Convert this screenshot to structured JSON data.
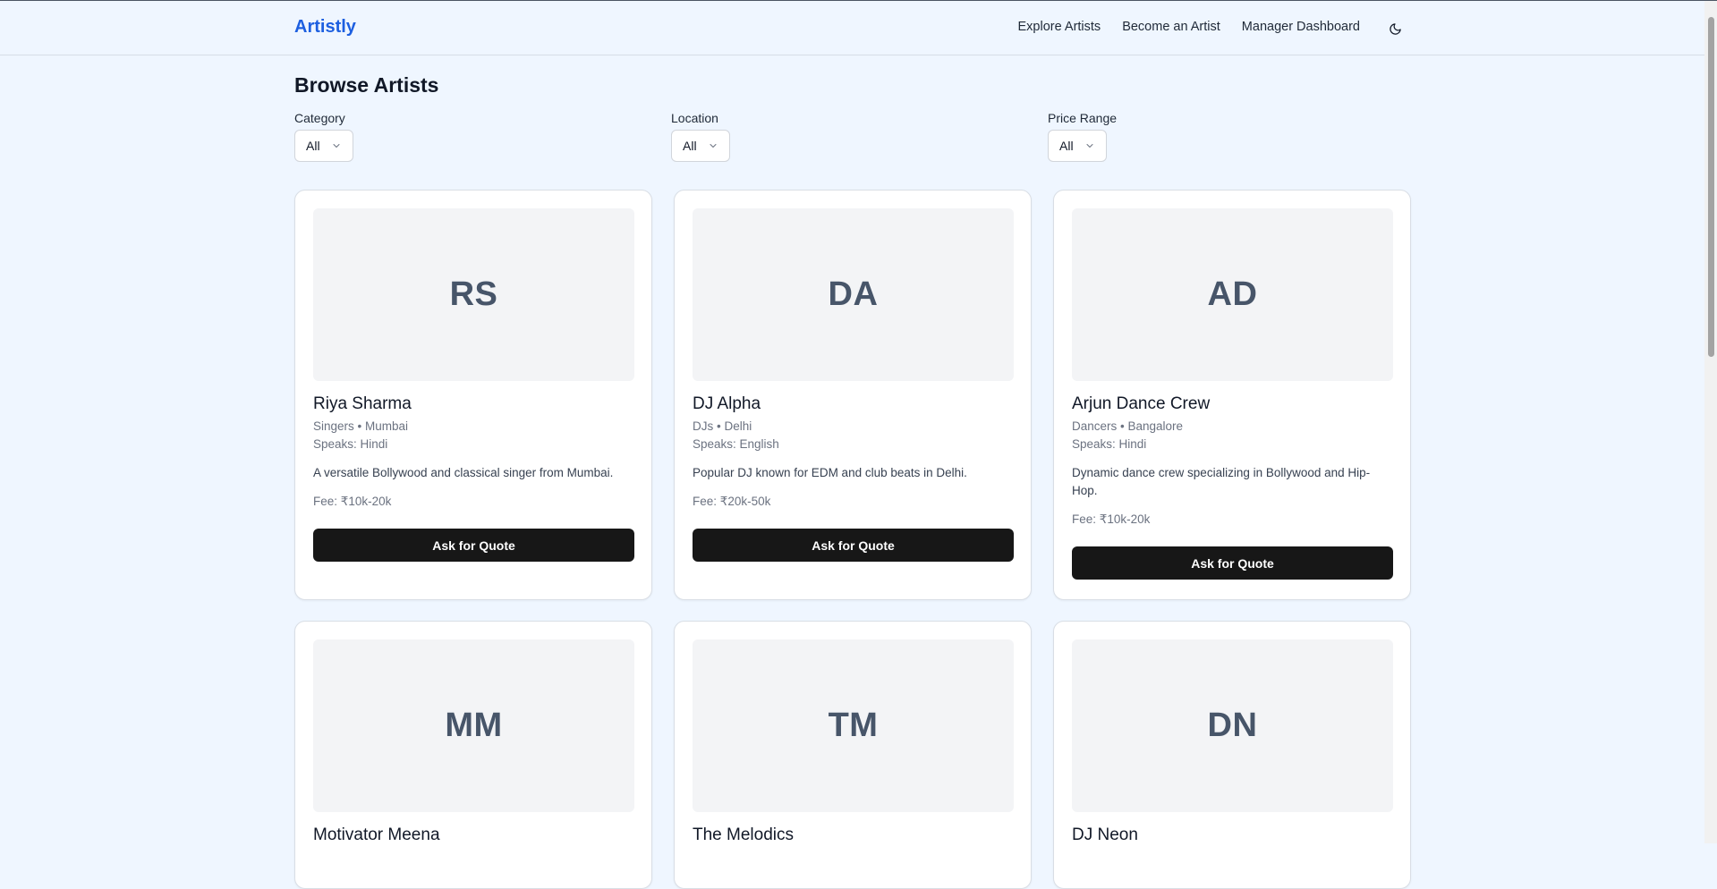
{
  "header": {
    "brand": "Artistly",
    "nav": [
      "Explore Artists",
      "Become an Artist",
      "Manager Dashboard"
    ],
    "theme_icon": "moon-icon"
  },
  "page": {
    "title": "Browse Artists"
  },
  "filters": [
    {
      "label": "Category",
      "value": "All"
    },
    {
      "label": "Location",
      "value": "All"
    },
    {
      "label": "Price Range",
      "value": "All"
    }
  ],
  "cards": [
    {
      "initials": "RS",
      "name": "Riya Sharma",
      "meta": "Singers • Mumbai",
      "speaks": "Speaks: Hindi",
      "description": "A versatile Bollywood and classical singer from Mumbai.",
      "fee": "Fee: ₹10k-20k",
      "button": "Ask for Quote"
    },
    {
      "initials": "DA",
      "name": "DJ Alpha",
      "meta": "DJs • Delhi",
      "speaks": "Speaks: English",
      "description": "Popular DJ known for EDM and club beats in Delhi.",
      "fee": "Fee: ₹20k-50k",
      "button": "Ask for Quote"
    },
    {
      "initials": "AD",
      "name": "Arjun Dance Crew",
      "meta": "Dancers • Bangalore",
      "speaks": "Speaks: Hindi",
      "description": "Dynamic dance crew specializing in Bollywood and Hip-Hop.",
      "fee": "Fee: ₹10k-20k",
      "button": "Ask for Quote"
    },
    {
      "initials": "MM",
      "name": "Motivator Meena"
    },
    {
      "initials": "TM",
      "name": "The Melodics"
    },
    {
      "initials": "DN",
      "name": "DJ Neon"
    }
  ]
}
